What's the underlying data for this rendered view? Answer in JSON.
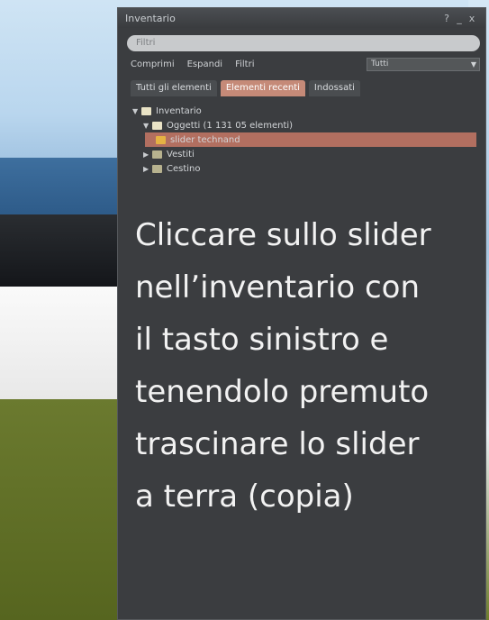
{
  "window": {
    "title": "Inventario",
    "controls": [
      "?",
      "_",
      "x"
    ]
  },
  "search": {
    "placeholder": "Filtri"
  },
  "menubar": {
    "items": [
      "Comprimi",
      "Espandi",
      "Filtri"
    ],
    "filter_value": "Tutti"
  },
  "tabs": [
    {
      "label": "Tutti gli elementi",
      "active": false
    },
    {
      "label": "Elementi recenti",
      "active": true
    },
    {
      "label": "Indossati",
      "active": false
    }
  ],
  "tree": [
    {
      "label": "Inventario",
      "level": 0
    },
    {
      "label": "Oggetti (1 131 05 elementi)",
      "level": 1
    },
    {
      "label": "slider technand",
      "level": 2,
      "selected": true
    },
    {
      "label": "Vestiti",
      "level": 1
    },
    {
      "label": "Cestino",
      "level": 1
    }
  ],
  "overlay_text": [
    "Cliccare sullo slider",
    "nell’inventario con",
    "il tasto sinistro e",
    "tenendolo premuto",
    "trascinare lo slider",
    "a terra (copia)"
  ],
  "colors": {
    "window_bg": "#3b3d40",
    "active_tab": "#c58a78",
    "selection": "#b26f60"
  }
}
